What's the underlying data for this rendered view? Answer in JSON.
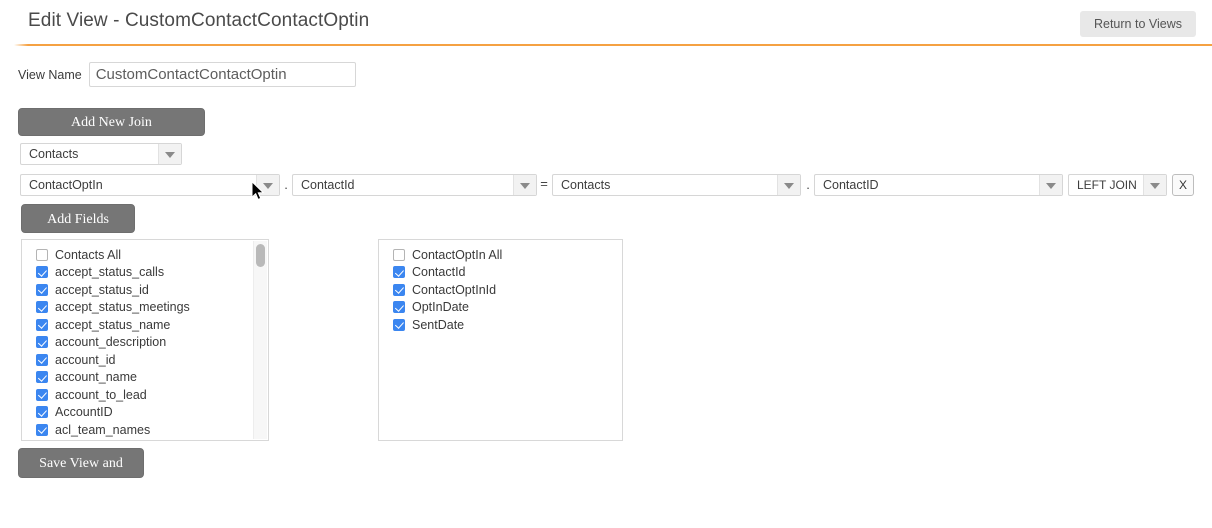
{
  "header": {
    "title": "Edit View - CustomContactContactOptin",
    "return_button_label": "Return to Views",
    "accent_color": "#f5a142"
  },
  "view_name": {
    "label": "View Name",
    "value": "CustomContactContactOptin",
    "placeholder": ""
  },
  "buttons": {
    "add_new_join": "Add New Join",
    "add_fields": "Add Fields",
    "save_view_and_return": "Save View and Return"
  },
  "base_table_select": {
    "value": "Contacts",
    "arrow_icon": "chevron-down-icon"
  },
  "join_row": {
    "left_table": "ContactOptIn",
    "dot_left": ".",
    "left_field": "ContactId",
    "equals": "=",
    "right_table": "Contacts",
    "dot_right": ".",
    "right_field": "ContactID",
    "join_type": "LEFT JOIN",
    "remove_label": "X"
  },
  "field_panels": [
    {
      "name": "contacts",
      "has_scrollbar": true,
      "items": [
        {
          "label": "Contacts All",
          "checked": false
        },
        {
          "label": "accept_status_calls",
          "checked": true
        },
        {
          "label": "accept_status_id",
          "checked": true
        },
        {
          "label": "accept_status_meetings",
          "checked": true
        },
        {
          "label": "accept_status_name",
          "checked": true
        },
        {
          "label": "account_description",
          "checked": true
        },
        {
          "label": "account_id",
          "checked": true
        },
        {
          "label": "account_name",
          "checked": true
        },
        {
          "label": "account_to_lead",
          "checked": true
        },
        {
          "label": "AccountID",
          "checked": true
        },
        {
          "label": "acl_team_names",
          "checked": true
        },
        {
          "label": "",
          "checked": true
        }
      ]
    },
    {
      "name": "contactoptin",
      "has_scrollbar": false,
      "items": [
        {
          "label": "ContactOptIn All",
          "checked": false
        },
        {
          "label": "ContactId",
          "checked": true
        },
        {
          "label": "ContactOptInId",
          "checked": true
        },
        {
          "label": "OptInDate",
          "checked": true
        },
        {
          "label": "SentDate",
          "checked": true
        }
      ]
    }
  ],
  "colors": {
    "checkbox_checked": "#3b86f0",
    "button_gray": "#767676",
    "accent_orange": "#f5a142"
  }
}
